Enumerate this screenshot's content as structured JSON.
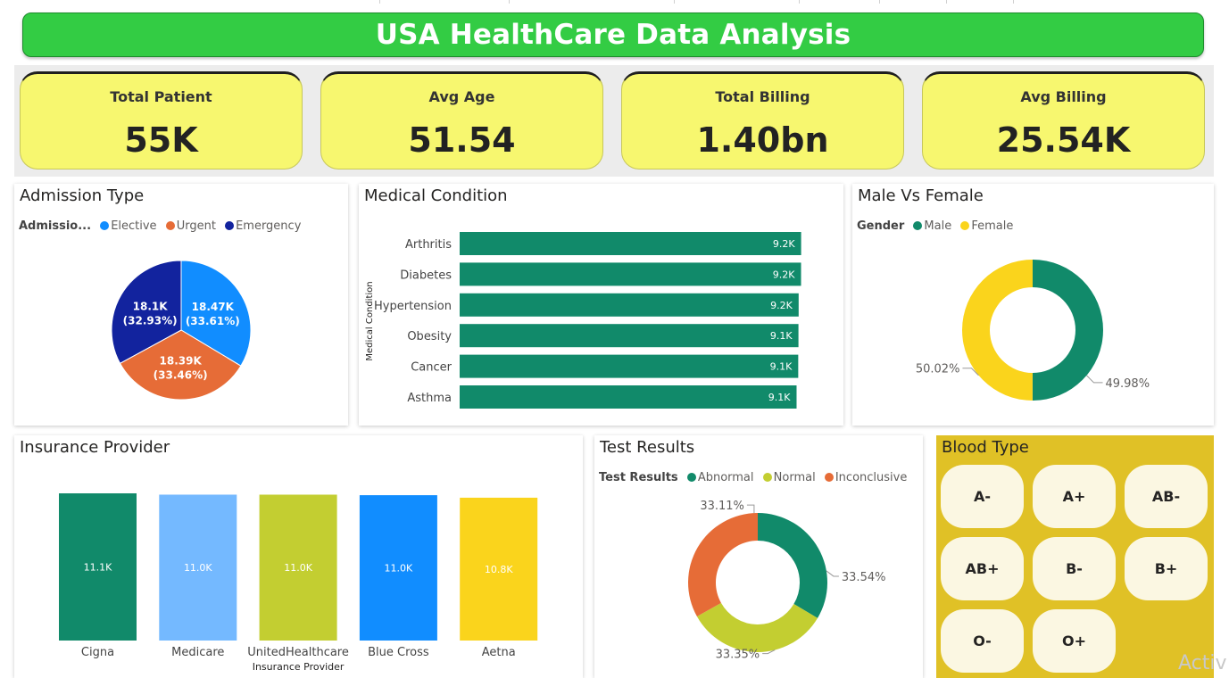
{
  "title": "USA HealthCare Data Analysis",
  "kpis": [
    {
      "label": "Total Patient",
      "value": "55K"
    },
    {
      "label": "Avg Age",
      "value": "51.54"
    },
    {
      "label": "Total Billing",
      "value": "1.40bn"
    },
    {
      "label": "Avg Billing",
      "value": "25.54K"
    }
  ],
  "admission": {
    "title": "Admission Type",
    "legend_title": "Admissio...",
    "legend": [
      "Elective",
      "Urgent",
      "Emergency"
    ],
    "colors": [
      "#118dff",
      "#e66c37",
      "#12239e"
    ],
    "chart_data": {
      "type": "pie",
      "categories": [
        "Elective",
        "Urgent",
        "Emergency"
      ],
      "values": [
        18470,
        18390,
        18100
      ],
      "percent": [
        33.61,
        33.46,
        32.93
      ],
      "labels": [
        [
          "18.47K",
          "(33.61%)"
        ],
        [
          "18.39K",
          "(33.46%)"
        ],
        [
          "18.1K",
          "(32.93%)"
        ]
      ]
    }
  },
  "medical": {
    "title": "Medical Condition",
    "axis_label": "Medical Condition",
    "color": "#118a6a",
    "chart_data": {
      "type": "bar",
      "orientation": "horizontal",
      "categories": [
        "Arthritis",
        "Diabetes",
        "Hypertension",
        "Obesity",
        "Cancer",
        "Asthma"
      ],
      "values": [
        9218,
        9216,
        9151,
        9146,
        9140,
        9095
      ],
      "labels": [
        "9.2K",
        "9.2K",
        "9.2K",
        "9.1K",
        "9.1K",
        "9.1K"
      ],
      "xlim": [
        0,
        9300
      ]
    }
  },
  "gender": {
    "title": "Male Vs Female",
    "legend_title": "Gender",
    "legend": [
      "Male",
      "Female"
    ],
    "colors": [
      "#118a6a",
      "#fad41c"
    ],
    "chart_data": {
      "type": "pie",
      "categories": [
        "Male",
        "Female"
      ],
      "values": [
        50.02,
        49.98
      ],
      "labels": [
        "50.02%",
        "49.98%"
      ]
    }
  },
  "insurance": {
    "title": "Insurance Provider",
    "axis_label": "Insurance Provider",
    "colors": [
      "#118a6a",
      "#74b9ff",
      "#c3ce31",
      "#118dff",
      "#fad41c"
    ],
    "chart_data": {
      "type": "bar",
      "categories": [
        "Cigna",
        "Medicare",
        "UnitedHealthcare",
        "Blue Cross",
        "Aetna"
      ],
      "values": [
        11140,
        11040,
        11040,
        11000,
        10810
      ],
      "labels": [
        "11.1K",
        "11.0K",
        "11.0K",
        "11.0K",
        "10.8K"
      ],
      "ylim": [
        0,
        11140
      ]
    }
  },
  "tests": {
    "title": "Test Results",
    "legend_title": "Test Results",
    "legend": [
      "Abnormal",
      "Normal",
      "Inconclusive"
    ],
    "colors": [
      "#118a6a",
      "#c3ce31",
      "#e66c37"
    ],
    "chart_data": {
      "type": "pie",
      "categories": [
        "Abnormal",
        "Normal",
        "Inconclusive"
      ],
      "values": [
        33.54,
        33.35,
        33.11
      ],
      "labels": [
        "33.54%",
        "33.35%",
        "33.11%"
      ]
    }
  },
  "blood": {
    "title": "Blood Type",
    "types": [
      "A-",
      "A+",
      "AB-",
      "AB+",
      "B-",
      "B+",
      "O-",
      "O+"
    ]
  },
  "watermark": "Activ"
}
